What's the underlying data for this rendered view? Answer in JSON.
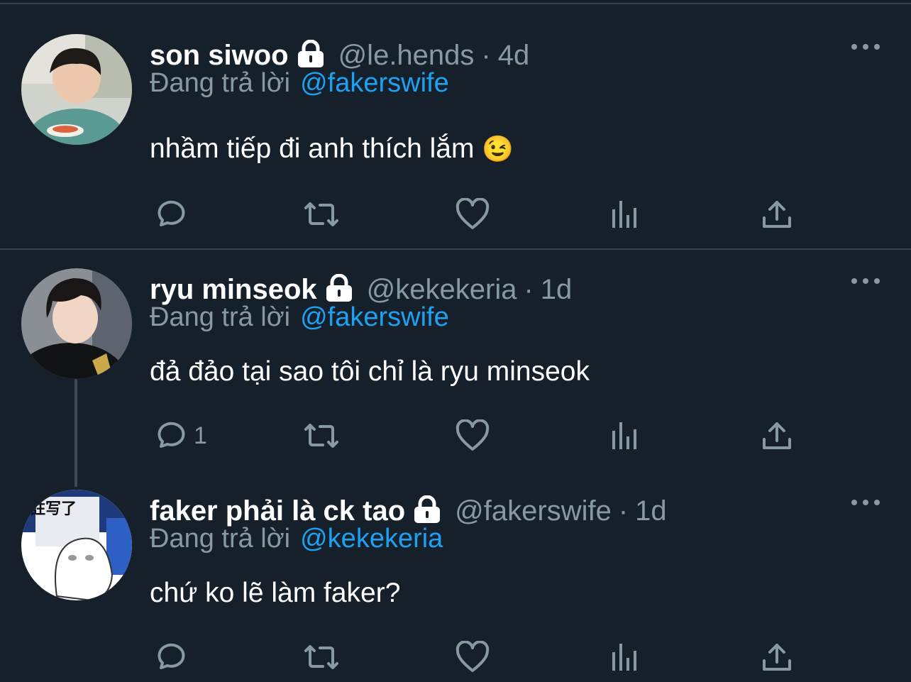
{
  "tweets": [
    {
      "name": "son siwoo",
      "handle": "@le.hends",
      "separator": "·",
      "time": "4d",
      "reply_prefix": "Đang trả lời",
      "reply_to": "@fakerswife",
      "text": "nhầm tiếp đi anh thích lắm",
      "emoji": "😉",
      "reply_count": ""
    },
    {
      "name": "ryu minseok",
      "handle": "@kekekeria",
      "separator": "·",
      "time": "1d",
      "reply_prefix": "Đang trả lời",
      "reply_to": "@fakerswife",
      "text": "đả đảo tại sao tôi chỉ là ryu minseok",
      "emoji": "",
      "reply_count": "1"
    },
    {
      "name": "faker phải là ck tao",
      "handle": "@fakerswife",
      "separator": "·",
      "time": "1d",
      "reply_prefix": "Đang trả lời",
      "reply_to": "@kekekeria",
      "text": "chứ ko lẽ làm faker?",
      "emoji": "",
      "reply_count": "",
      "avatar_text": "註写了"
    }
  ],
  "icons": [
    "lock-icon",
    "more-icon",
    "reply-icon",
    "retweet-icon",
    "like-icon",
    "analytics-icon",
    "share-icon"
  ],
  "colors": {
    "background": "#15202b",
    "secondary": "#8899a6",
    "accent": "#1da1f2",
    "divider": "#38444d"
  }
}
